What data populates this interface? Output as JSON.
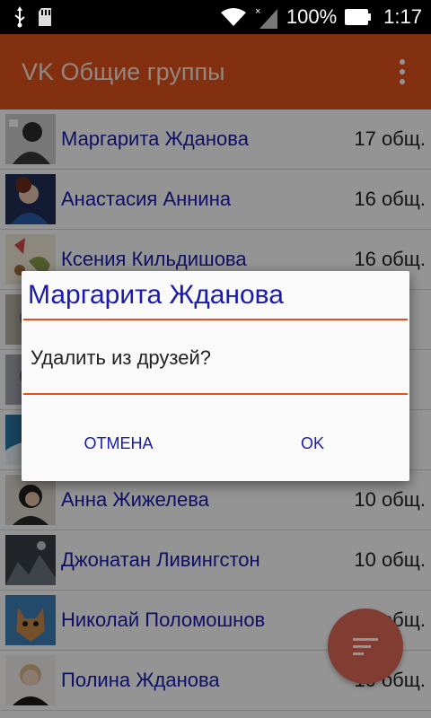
{
  "status_bar": {
    "battery": "100%",
    "time": "1:17",
    "icons": [
      "usb-icon",
      "sd-card-icon",
      "wifi-icon",
      "no-signal-icon",
      "battery-icon"
    ]
  },
  "app_bar": {
    "title": "VK Общие группы",
    "menu_icon": "overflow-menu-icon"
  },
  "friends": [
    {
      "name": "Маргарита Жданова",
      "count": "17 общ."
    },
    {
      "name": "Анастасия Аннина",
      "count": "16 общ."
    },
    {
      "name": "Ксения Кильдишова",
      "count": "16 общ."
    },
    {
      "name": "",
      "count": ""
    },
    {
      "name": "",
      "count": ""
    },
    {
      "name": "",
      "count": ""
    },
    {
      "name": "Анна Жижелева",
      "count": "10 общ."
    },
    {
      "name": "Джонатан Ливингстон",
      "count": "10 общ."
    },
    {
      "name": "Николай Поломошнов",
      "count": "10 общ."
    },
    {
      "name": "Полина Жданова",
      "count": "10 общ."
    }
  ],
  "dialog": {
    "title": "Маргарита Жданова",
    "message": "Удалить из друзей?",
    "cancel": "ОТМЕНА",
    "ok": "OK"
  },
  "fab": {
    "icon": "sort-icon"
  },
  "colors": {
    "accent": "#e0531b",
    "link": "#1a1ab0",
    "fab": "#e06a56"
  }
}
